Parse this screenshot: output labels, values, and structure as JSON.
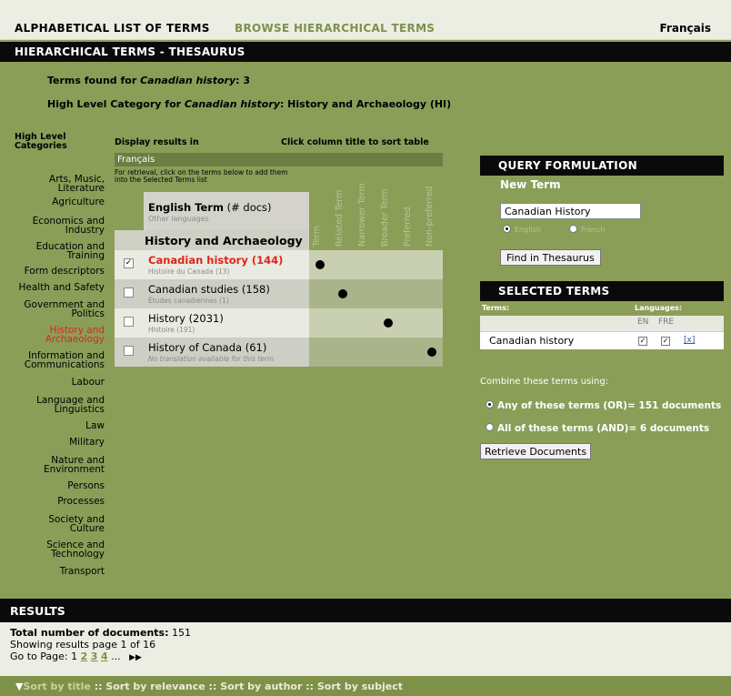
{
  "topnav": {
    "alphabetical": "ALPHABETICAL LIST OF TERMS",
    "browse": "BROWSE HIERARCHICAL TERMS",
    "language": "Français"
  },
  "section_title": "HIERARCHICAL TERMS - THESAURUS",
  "info": {
    "terms_found_prefix": "Terms found for ",
    "terms_found_term": "Canadian history",
    "terms_found_suffix": ": 3",
    "hlc_prefix": "High Level Category for ",
    "hlc_term": "Canadian history",
    "hlc_suffix": ": History and Archaeology (HI)"
  },
  "headers": {
    "categories_line1": "High Level",
    "categories_line2": "Categories",
    "display_in": "Display results in",
    "sort_hint": "Click column title to sort table",
    "display_language": "Français",
    "retrieval_hint_line1": "For retrieval, click on the terms below to add them",
    "retrieval_hint_line2": "into the Selected Terms list"
  },
  "categories": [
    {
      "line1": "Arts, Music,",
      "line2": "Literature",
      "active": false
    },
    {
      "line1": "Agriculture",
      "line2": "",
      "active": false
    },
    {
      "line1": "Economics and",
      "line2": "Industry",
      "active": false
    },
    {
      "line1": "Education and",
      "line2": "Training",
      "active": false
    },
    {
      "line1": "Form descriptors",
      "line2": "",
      "active": false
    },
    {
      "line1": "Health and Safety",
      "line2": "",
      "active": false
    },
    {
      "line1": "Government and",
      "line2": "Politics",
      "active": false
    },
    {
      "line1": "History and",
      "line2": "Archaeology",
      "active": true
    },
    {
      "line1": "Information and",
      "line2": "Communications",
      "active": false
    },
    {
      "line1": "Labour",
      "line2": "",
      "active": false
    },
    {
      "line1": "Language and",
      "line2": "Linguistics",
      "active": false
    },
    {
      "line1": "Law",
      "line2": "",
      "active": false
    },
    {
      "line1": "Military",
      "line2": "",
      "active": false
    },
    {
      "line1": "Nature and",
      "line2": "Environment",
      "active": false
    },
    {
      "line1": "Persons",
      "line2": "",
      "active": false
    },
    {
      "line1": "Processes",
      "line2": "",
      "active": false
    },
    {
      "line1": "Society and",
      "line2": "Culture",
      "active": false
    },
    {
      "line1": "Science and",
      "line2": "Technology",
      "active": false
    },
    {
      "line1": "Transport",
      "line2": "",
      "active": false
    }
  ],
  "table": {
    "col_title": "English Term",
    "col_title_suffix": " (# docs)",
    "col_subtitle": "Other languages",
    "relation_columns": [
      "Term",
      "Related Term",
      "Narrower Term",
      "Broader Term",
      "Preferred",
      "Non-preferred"
    ],
    "group_title": "History and Archaeology",
    "rows": [
      {
        "term": "Canadian history (144)",
        "translation": "Histoire du Canada (13)",
        "checked": true,
        "highlight": true,
        "relation_index": 0
      },
      {
        "term": "Canadian studies (158)",
        "translation": "Études canadiennes (1)",
        "checked": false,
        "highlight": false,
        "relation_index": 1
      },
      {
        "term": "History (2031)",
        "translation": "Histoire (191)",
        "checked": false,
        "highlight": false,
        "relation_index": 3
      },
      {
        "term": "History of Canada (61)",
        "translation": "No translation available for this term",
        "checked": false,
        "highlight": false,
        "relation_index": 5
      }
    ]
  },
  "query": {
    "title": "QUERY FORMULATION",
    "new_term_label": "New Term",
    "input_value": "Canadian History",
    "radio_english": "English",
    "radio_french": "French",
    "find_button": "Find in Thesaurus"
  },
  "selected": {
    "title": "SELECTED TERMS",
    "terms_label": "Terms:",
    "languages_label": "Languages:",
    "en_label": "EN",
    "fre_label": "FRE",
    "items": [
      {
        "term": "Canadian history",
        "en": true,
        "fre": true,
        "remove": "[x]"
      }
    ]
  },
  "combine": {
    "label": "Combine these terms using:",
    "option_or": "Any of these terms (OR)= 151 documents",
    "option_and": "All of these terms (AND)= 6 documents",
    "retrieve_button": "Retrieve Documents"
  },
  "results": {
    "title": "RESULTS",
    "total_label": "Total number of documents:",
    "total_value": "151",
    "showing": "Showing results page 1 of 16",
    "goto_label": "Go to Page:",
    "current_page": "1",
    "pages": [
      "2",
      "3",
      "4"
    ],
    "ellipsis": "...",
    "next": "▶▶"
  },
  "sort": {
    "arrow": "▼",
    "by_title": "Sort by title",
    "sep": " :: ",
    "by_relevance": "Sort by relevance",
    "by_author": "Sort by author",
    "by_subject": "Sort by subject"
  },
  "colors": {
    "accent_red": "#e0241a",
    "olive_bg": "#8a9e58",
    "dark_olive": "#7e9149"
  }
}
